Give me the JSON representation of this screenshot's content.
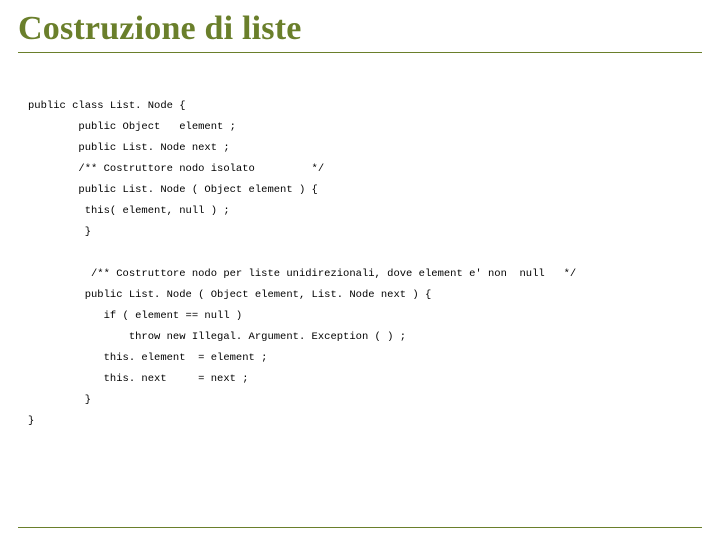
{
  "title": "Costruzione di liste",
  "code": {
    "l01": "public class List. Node {",
    "l02": "        public Object   element ;",
    "l03": "        public List. Node next ;",
    "l04": "        /** Costruttore nodo isolato         */",
    "l05": "        public List. Node ( Object element ) {",
    "l06": "         this( element, null ) ;",
    "l07": "         }",
    "l08": "          /** Costruttore nodo per liste unidirezionali, dove element e' non  null   */",
    "l09": "         public List. Node ( Object element, List. Node next ) {",
    "l10": "            if ( element == null )",
    "l11": "                throw new Illegal. Argument. Exception ( ) ;",
    "l12": "            this. element  = element ;",
    "l13": "            this. next     = next ;",
    "l14": "         }",
    "l15": "}"
  }
}
